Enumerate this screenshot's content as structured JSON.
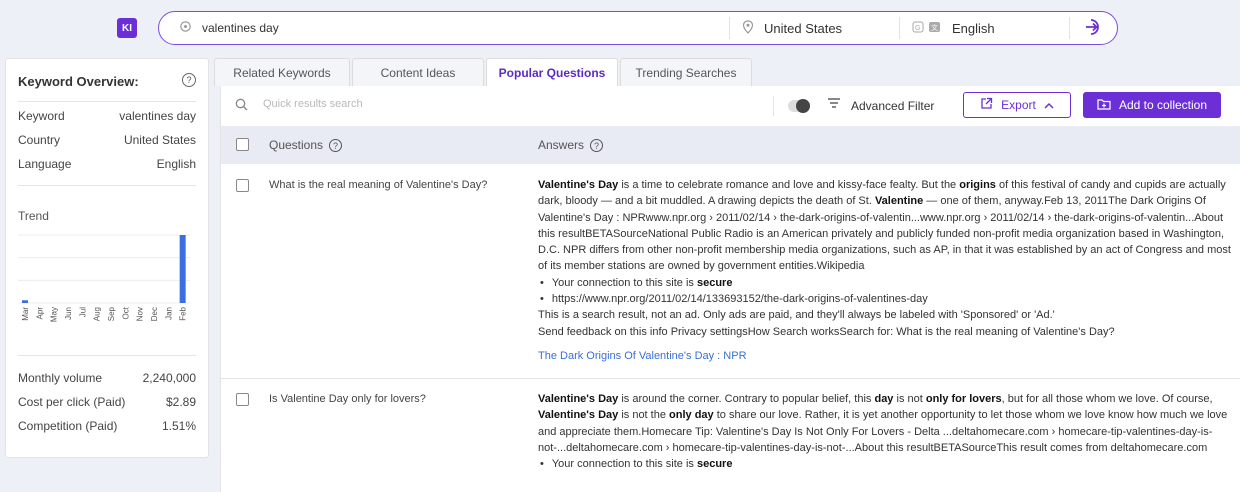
{
  "header": {
    "logo": "KI",
    "keyword": "valentines day",
    "country": "United States",
    "language": "English"
  },
  "overview": {
    "title": "Keyword Overview:",
    "help": "?",
    "rows": [
      {
        "label": "Keyword",
        "value": "valentines day"
      },
      {
        "label": "Country",
        "value": "United States"
      },
      {
        "label": "Language",
        "value": "English"
      }
    ],
    "trend_label": "Trend",
    "trend_months": [
      "Mar",
      "Apr",
      "May",
      "Jun",
      "Jul",
      "Aug",
      "Sep",
      "Oct",
      "Nov",
      "Dec",
      "Jan",
      "Feb"
    ],
    "trend_values": [
      4,
      0,
      0,
      0,
      0,
      0,
      0,
      0,
      0,
      0,
      0,
      100
    ],
    "metrics": [
      {
        "label": "Monthly volume",
        "value": "2,240,000"
      },
      {
        "label": "Cost per click (Paid)",
        "value": "$2.89"
      },
      {
        "label": "Competition (Paid)",
        "value": "1.51%"
      }
    ]
  },
  "tabs": [
    "Related Keywords",
    "Content Ideas",
    "Popular Questions",
    "Trending Searches"
  ],
  "toolbar": {
    "search_placeholder": "Quick results search",
    "advanced_filter": "Advanced Filter",
    "export": "Export",
    "add_to_collection": "Add to collection"
  },
  "table": {
    "col_questions": "Questions",
    "col_answers": "Answers",
    "rows": [
      {
        "question": "What is the real meaning of Valentine's Day?",
        "answer_html": "<b>Valentine's Day</b> is a time to celebrate romance and love and kissy-face fealty. But the <b>origins</b> of this festival of candy and cupids are actually dark, bloody — and a bit muddled. A drawing depicts the death of St. <b>Valentine</b> — one of them, anyway.Feb 13, 2011The Dark Origins Of Valentine's Day : NPRwww.npr.org › 2011/02/14 › the-dark-origins-of-valentin...www.npr.org › 2011/02/14 › the-dark-origins-of-valentin...About this resultBETASourceNational Public Radio is an American privately and publicly funded non-profit media organization based in Washington, D.C. NPR differs from other non-profit membership media organizations, such as AP, in that it was established by an act of Congress and most of its member stations are owned by government entities.Wikipedia<ul><li>Your connection to this site is <b>secure</b></li><li>https://www.npr.org/2011/02/14/133693152/the-dark-origins-of-valentines-day</li></ul>This is a search result, not an ad. Only ads are paid, and they'll always be labeled with 'Sponsored' or 'Ad.'<br>Send feedback on this info Privacy settingsHow Search worksSearch for: What is the real meaning of Valentine's Day?",
        "link": "The Dark Origins Of Valentine's Day : NPR"
      },
      {
        "question": "Is Valentine Day only for lovers?",
        "answer_html": "<b>Valentine's Day</b> is around the corner. Contrary to popular belief, this <b>day</b> is not <b>only for lovers</b>, but for all those whom we love. Of course, <b>Valentine's Day</b> is not the <b>only day</b> to share our love. Rather, it is yet another opportunity to let those whom we love know how much we love and appreciate them.Homecare Tip: Valentine's Day Is Not Only For Lovers - Delta ...deltahomecare.com › homecare-tip-valentines-day-is-not-...deltahomecare.com › homecare-tip-valentines-day-is-not-...About this resultBETASourceThis result comes from deltahomecare.com<ul><li>Your connection to this site is <b>secure</b></li></ul>",
        "link": ""
      }
    ]
  },
  "colors": {
    "accent": "#6c2fd6",
    "link": "#3a6fd8",
    "trend_bar": "#3b6fe0",
    "header_bg": "#e8eaf4"
  }
}
